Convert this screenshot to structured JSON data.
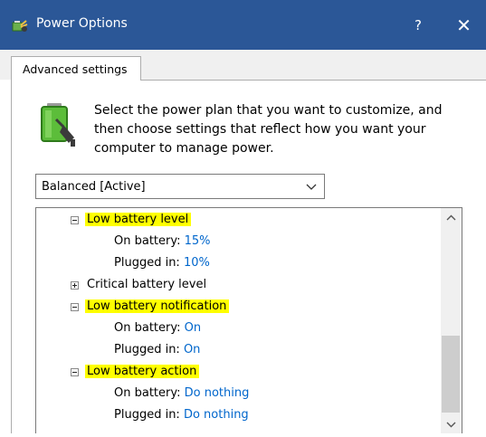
{
  "window": {
    "title": "Power Options",
    "help_label": "?",
    "close_label": "✕",
    "titlebar_color": "#2b5797"
  },
  "tabs": [
    {
      "label": "Advanced settings",
      "selected": true
    }
  ],
  "intro": {
    "text": "Select the power plan that you want to customize, and then choose settings that reflect how you want your computer to manage power."
  },
  "plan_select": {
    "value": "Balanced [Active]"
  },
  "tree": {
    "low_battery_level": {
      "label": "Low battery level",
      "expanded": true,
      "highlighted": true,
      "on_battery_label": "On battery:",
      "on_battery_value": "15%",
      "plugged_in_label": "Plugged in:",
      "plugged_in_value": "10%"
    },
    "critical_battery_level": {
      "label": "Critical battery level",
      "expanded": false
    },
    "low_battery_notification": {
      "label": "Low battery notification",
      "expanded": true,
      "highlighted": true,
      "on_battery_label": "On battery:",
      "on_battery_value": "On",
      "plugged_in_label": "Plugged in:",
      "plugged_in_value": "On"
    },
    "low_battery_action": {
      "label": "Low battery action",
      "expanded": true,
      "highlighted": true,
      "on_battery_label": "On battery:",
      "on_battery_value": "Do nothing",
      "plugged_in_label": "Plugged in:",
      "plugged_in_value": "Do nothing"
    }
  },
  "colors": {
    "highlight": "#ffff00",
    "value_link": "#0066cc"
  },
  "icons": {
    "app": "power-options-icon",
    "battery": "battery-plug-icon",
    "collapse": "minus-box-icon",
    "expand": "plus-box-icon"
  }
}
